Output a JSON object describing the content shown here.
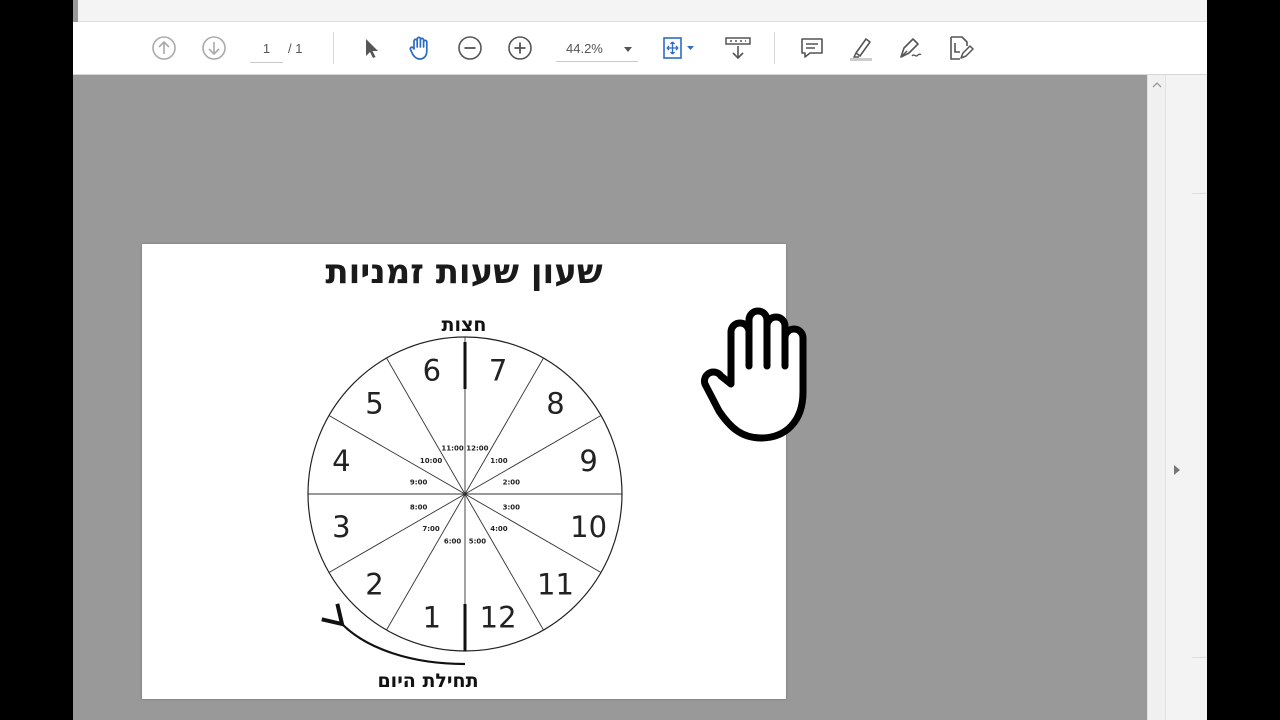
{
  "toolbar": {
    "prev_page_icon": "arrow-up-circle-icon",
    "next_page_icon": "arrow-down-circle-icon",
    "current_page": "1",
    "total_pages": "/ 1",
    "select_tool_icon": "pointer-arrow-icon",
    "hand_tool_icon": "hand-icon",
    "zoom_out_icon": "minus-circle-icon",
    "zoom_in_icon": "plus-circle-icon",
    "zoom_value": "44.2%",
    "fit_page_icon": "fit-page-icon",
    "scroll_mode_icon": "scroll-mode-icon",
    "comment_icon": "comment-icon",
    "highlight_icon": "highlighter-icon",
    "draw_icon": "pen-draw-icon",
    "fill_sign_icon": "fill-sign-icon",
    "accent_color": "#2b6cc4"
  },
  "document": {
    "title": "שעון שעות זמניות",
    "top_label": "חצות",
    "bottom_label": "תחילת היום",
    "zmaniyot_hours": [
      "1",
      "2",
      "3",
      "4",
      "5",
      "6",
      "7",
      "8",
      "9",
      "10",
      "11",
      "12"
    ],
    "clock_times": [
      "12:00",
      "1:00",
      "2:00",
      "3:00",
      "4:00",
      "5:00",
      "6:00",
      "7:00",
      "8:00",
      "9:00",
      "10:00",
      "11:00"
    ]
  }
}
